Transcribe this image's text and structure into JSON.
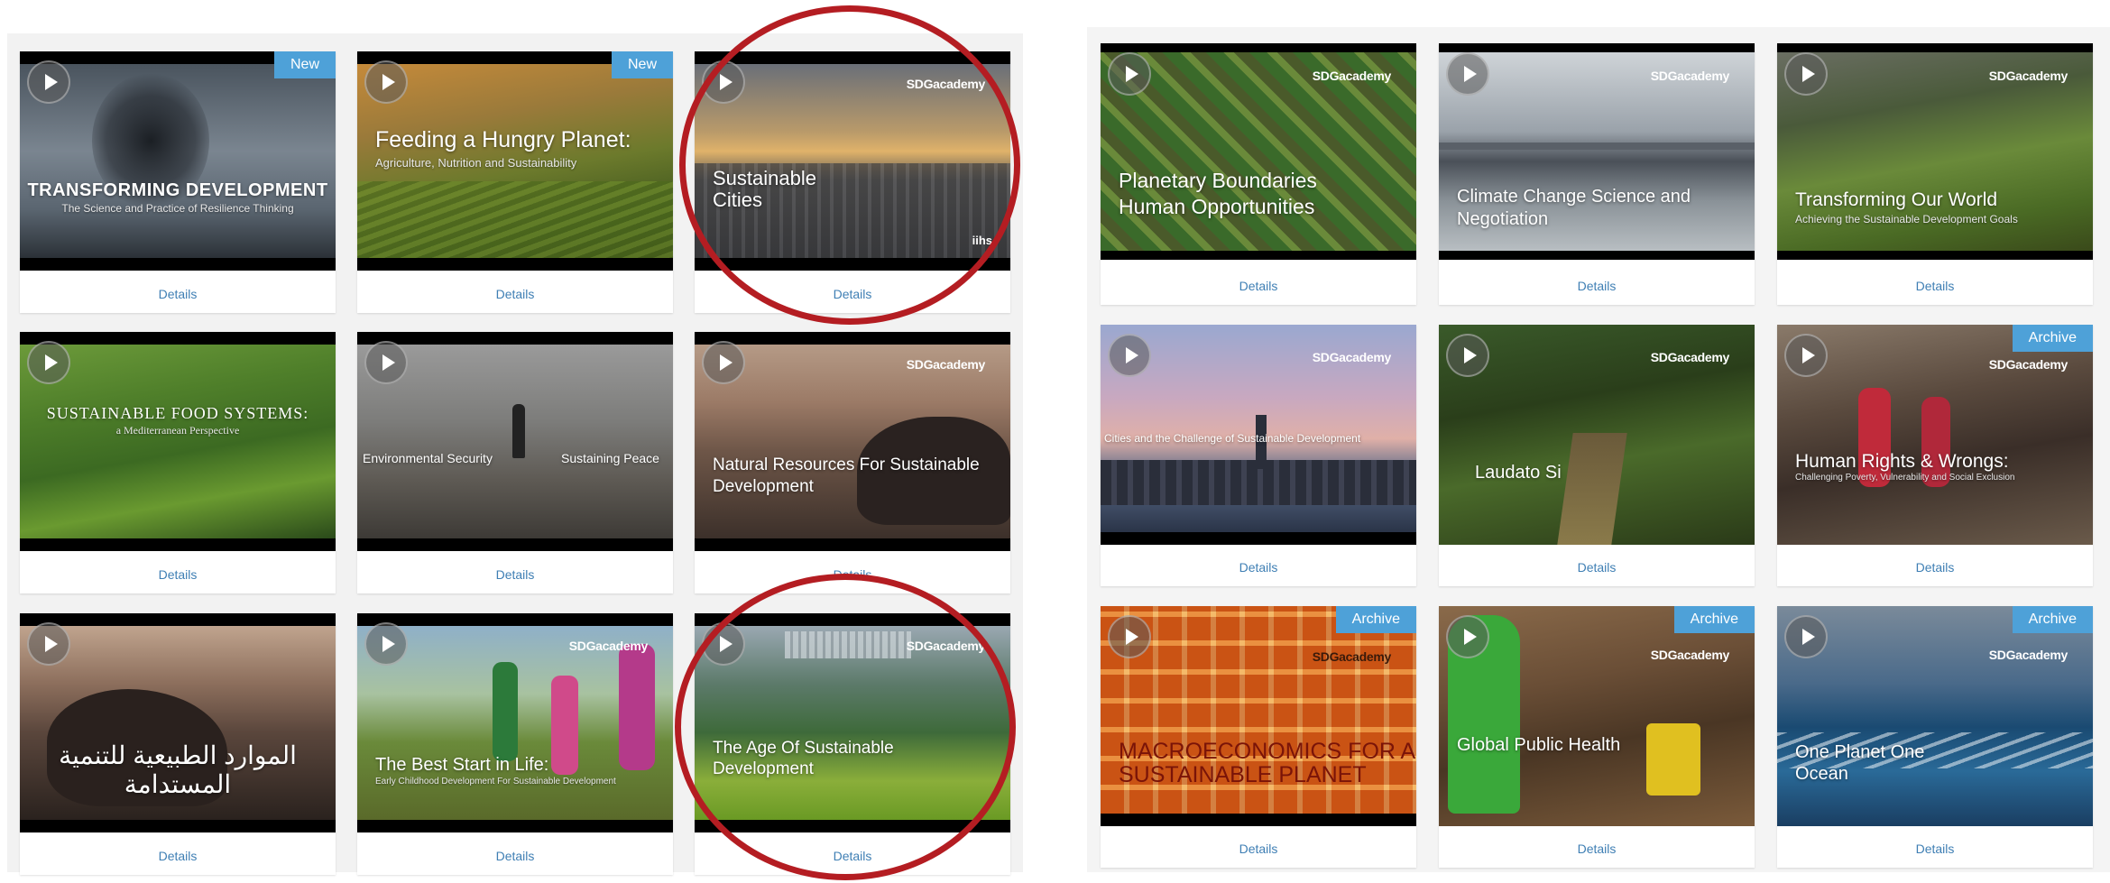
{
  "common": {
    "details_label": "Details",
    "logo_text": "SDGacademy"
  },
  "left_grid": [
    {
      "title": "TRANSFORMING DEVELOPMENT",
      "subtitle": "The Science and Practice of Resilience Thinking",
      "badge": "New",
      "logo": false,
      "image": "flock-sky"
    },
    {
      "title": "Feeding a Hungry Planet:",
      "subtitle": "Agriculture, Nutrition and Sustainability",
      "badge": "New",
      "logo": false,
      "image": "terraced-fields"
    },
    {
      "title": "Sustainable Cities",
      "subtitle": "",
      "badge": "",
      "logo": true,
      "image": "city-sunset",
      "extra": "iihs"
    },
    {
      "title": "SUSTAINABLE FOOD SYSTEMS:",
      "subtitle": "a Mediterranean Perspective",
      "badge": "",
      "logo": false,
      "image": "green-hills"
    },
    {
      "title": "Environmental Security",
      "title2": "Sustaining Peace",
      "badge": "",
      "logo": false,
      "image": "desert-person"
    },
    {
      "title": "Natural Resources For Sustainable Development",
      "subtitle": "",
      "badge": "",
      "logo": true,
      "image": "desert-rock"
    },
    {
      "title": "الموارد الطبيعية للتنمية المستدامة",
      "subtitle": "",
      "badge": "",
      "logo": false,
      "image": "desert-rock-arabic"
    },
    {
      "title": "The Best Start in Life:",
      "subtitle": "Early Childhood Development For Sustainable Development",
      "badge": "",
      "logo": true,
      "image": "children-jump"
    },
    {
      "title": "The Age Of Sustainable Development",
      "subtitle": "",
      "badge": "",
      "logo": true,
      "image": "green-valley-city"
    }
  ],
  "right_grid": [
    {
      "title": "Planetary Boundaries Human Opportunities",
      "subtitle": "",
      "badge": "",
      "logo": true,
      "image": "aerial-fields"
    },
    {
      "title": "Climate Change Science and Negotiation",
      "subtitle": "",
      "badge": "",
      "logo": true,
      "image": "flooded-trees"
    },
    {
      "title": "Transforming Our World",
      "subtitle": "Achieving the Sustainable Development Goals",
      "badge": "",
      "logo": true,
      "image": "mountain-valley"
    },
    {
      "title": "Cities and the Challenge of Sustainable Development",
      "subtitle": "",
      "badge": "",
      "logo": true,
      "image": "skyline-dusk"
    },
    {
      "title": "Laudato Si",
      "subtitle": "",
      "badge": "",
      "logo": true,
      "image": "forest-path"
    },
    {
      "title": "Human Rights & Wrongs:",
      "subtitle": "Challenging Poverty, Vulnerability and Social Exclusion",
      "badge": "Archive",
      "logo": true,
      "image": "girl-bridge"
    },
    {
      "title": "MACROECONOMICS FOR A SUSTAINABLE PLANET",
      "subtitle": "",
      "badge": "Archive",
      "logo": true,
      "image": "orange-grid"
    },
    {
      "title": "Global Public Health",
      "subtitle": "",
      "badge": "Archive",
      "logo": true,
      "image": "women-water"
    },
    {
      "title": "One Planet One Ocean",
      "subtitle": "",
      "badge": "Archive",
      "logo": true,
      "image": "ocean-waves"
    }
  ],
  "colors": {
    "link": "#3f7fb4",
    "badge": "#4ea1d8",
    "highlight_ring": "#b41d22"
  }
}
